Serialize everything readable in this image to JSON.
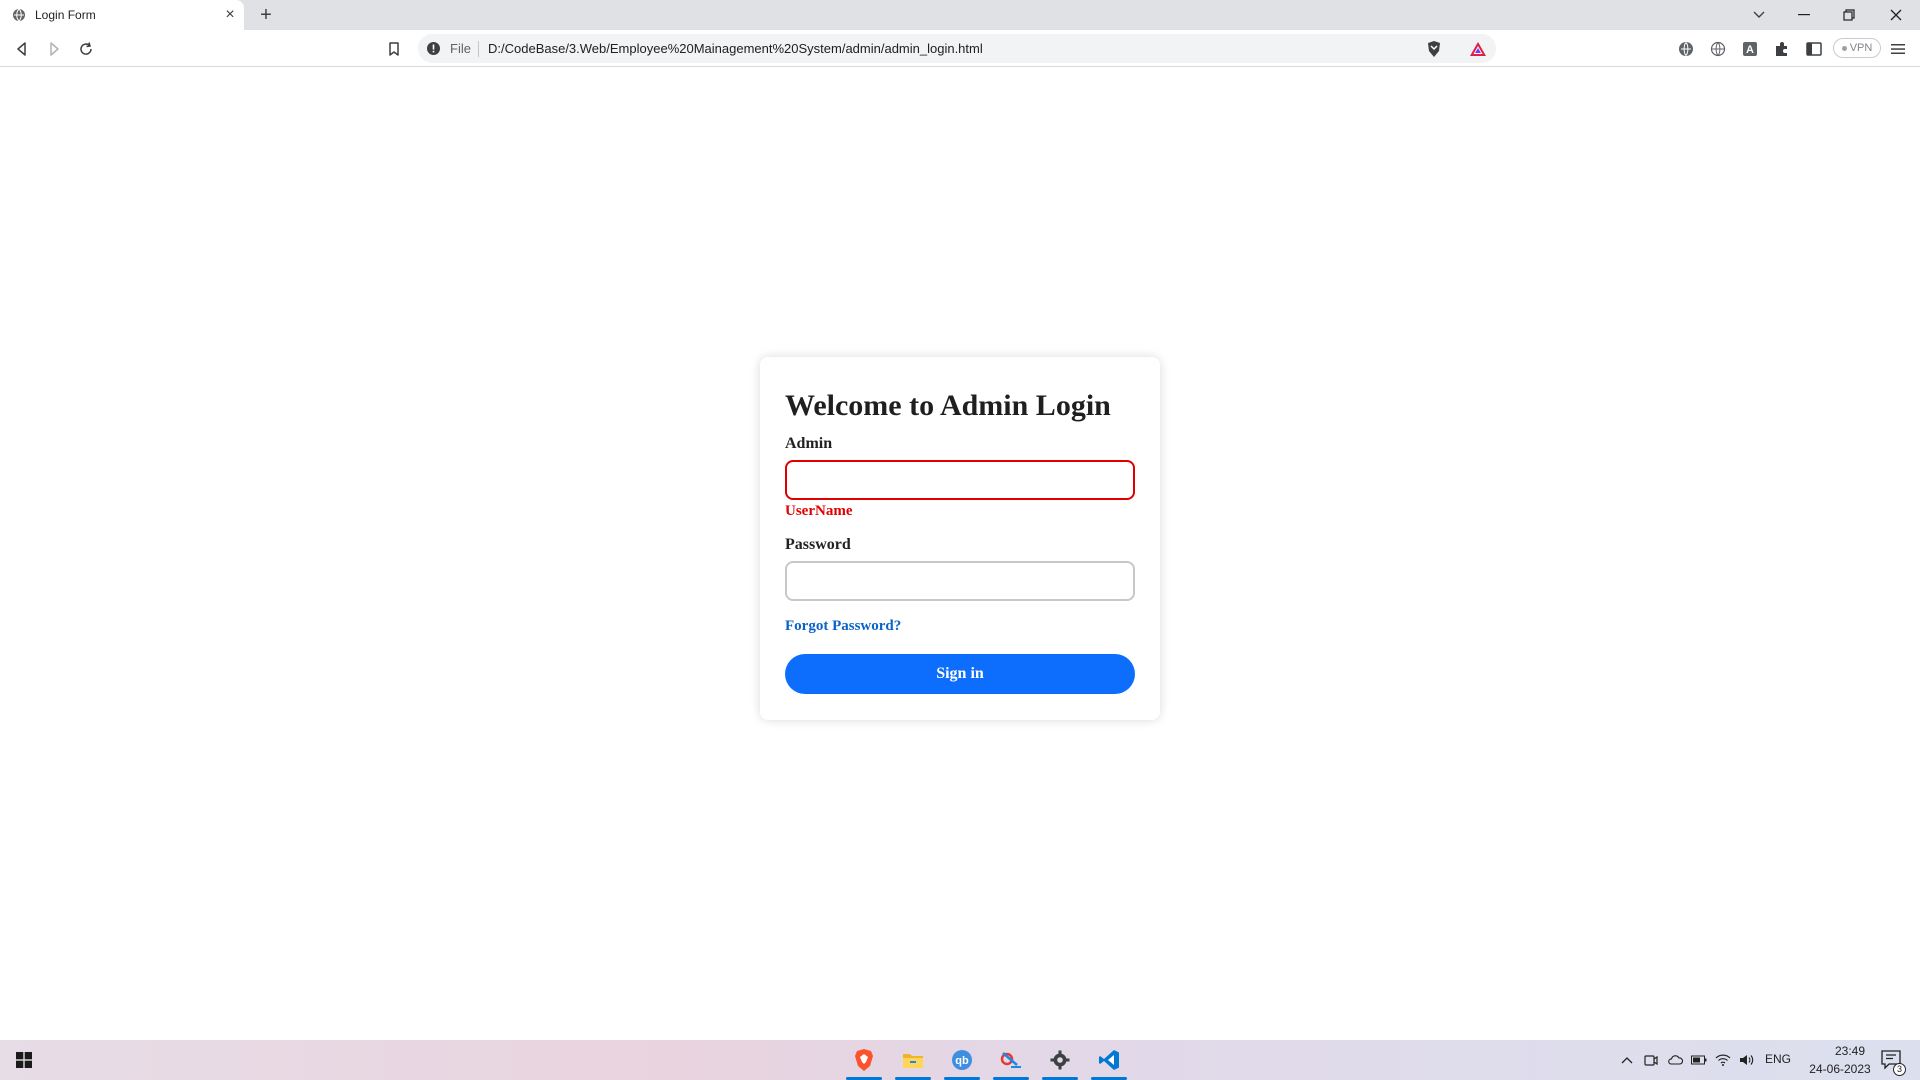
{
  "browser": {
    "tab_title": "Login Form",
    "tab_close": "×",
    "new_tab": "+",
    "omnibox_scheme": "File",
    "url": "D:/CodeBase/3.Web/Employee%20Mainagement%20System/admin/admin_login.html",
    "vpn_label": "VPN",
    "icons": [
      "back-icon",
      "forward-icon",
      "reload-icon",
      "bookmark-icon",
      "info-icon",
      "brave-shields-icon",
      "brave-rewards-icon",
      "translate-icon",
      "globe-icon",
      "dictionary-icon",
      "extensions-icon",
      "sidebar-icon",
      "menu-icon"
    ]
  },
  "login": {
    "title": "Welcome to Admin Login",
    "username_label": "Admin",
    "username_value": "",
    "username_error": "UserName",
    "password_label": "Password",
    "password_value": "",
    "forgot_link": "Forgot Password?",
    "signin_button": "Sign in",
    "error_color": "#e00000",
    "accent_color": "#0d6efd"
  },
  "taskbar": {
    "apps": [
      "brave-browser-icon",
      "file-explorer-icon",
      "qbittorrent-icon",
      "snipping-tool-icon",
      "settings-icon",
      "vscode-icon"
    ],
    "language": "ENG",
    "time": "23:49",
    "date": "24-06-2023",
    "notification_count": "3"
  }
}
